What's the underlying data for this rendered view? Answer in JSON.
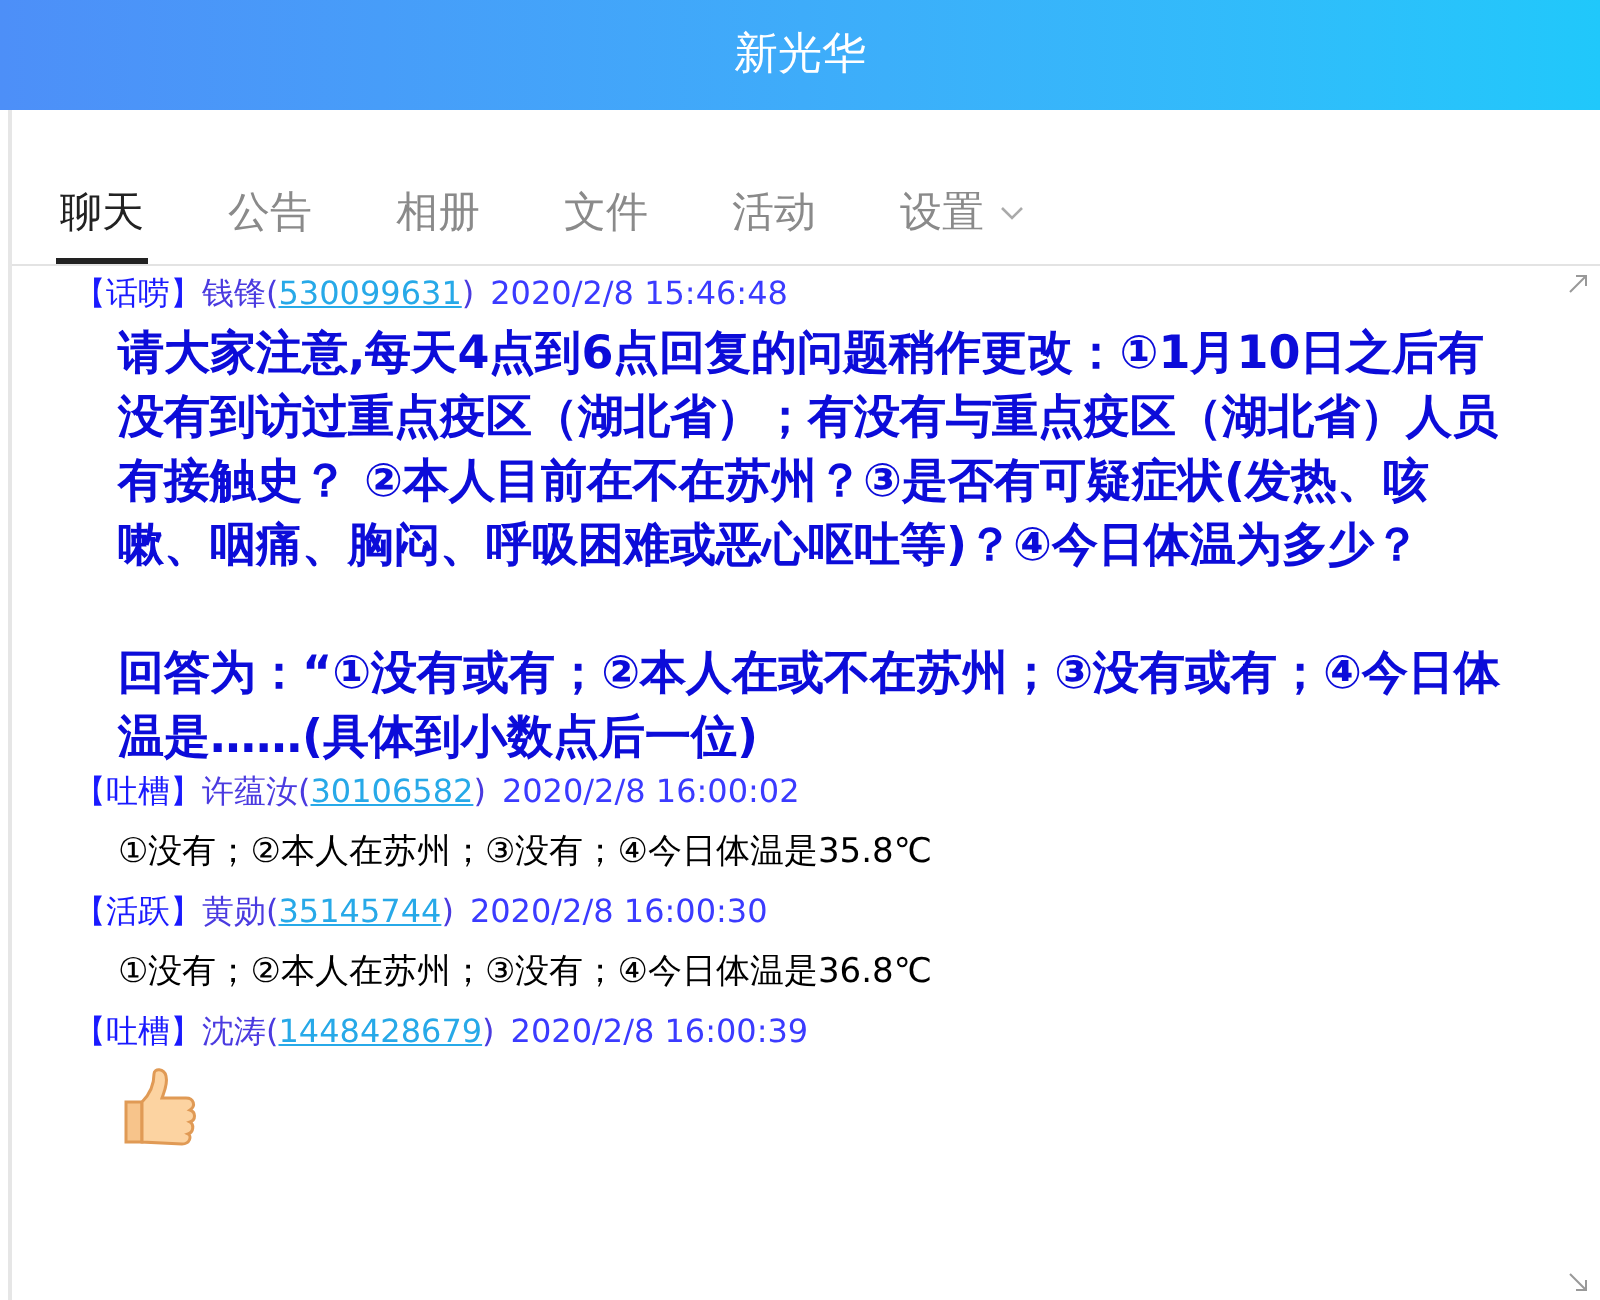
{
  "window": {
    "title": "新光华"
  },
  "tabs": [
    {
      "label": "聊天",
      "selected": true
    },
    {
      "label": "公告",
      "selected": false
    },
    {
      "label": "相册",
      "selected": false
    },
    {
      "label": "文件",
      "selected": false
    },
    {
      "label": "活动",
      "selected": false
    },
    {
      "label": "设置",
      "selected": false,
      "dropdown": true
    }
  ],
  "messages": [
    {
      "tag": "【话唠】",
      "name": "钱锋",
      "open": "(",
      "qq": "530099631",
      "close": ")",
      "time": "2020/2/8 15:46:48",
      "kind": "announcement",
      "paragraphs": [
        "请大家注意,每天4点到6点回复的问题稍作更改：①1月10日之后有没有到访过重点疫区（湖北省）；有没有与重点疫区（湖北省）人员有接触史？ ②本人目前在不在苏州？③是否有可疑症状(发热、咳嗽、咽痛、胸闷、呼吸困难或恶心呕吐等)？④今日体温为多少？",
        "回答为：“①没有或有；②本人在或不在苏州；③没有或有；④今日体温是……(具体到小数点后一位)"
      ]
    },
    {
      "tag": "【吐槽】",
      "name": "许蕴汝",
      "open": "(",
      "qq": "30106582",
      "close": ")",
      "time": "2020/2/8 16:00:02",
      "kind": "text",
      "text": "①没有；②本人在苏州；③没有；④今日体温是35.8℃"
    },
    {
      "tag": "【活跃】",
      "name": "黄勋",
      "open": "(",
      "qq": "35145744",
      "close": ")",
      "time": "2020/2/8 16:00:30",
      "kind": "text",
      "text": "①没有；②本人在苏州；③没有；④今日体温是36.8℃"
    },
    {
      "tag": "【吐槽】",
      "name": "沈涛",
      "open": "(",
      "qq": "1448428679",
      "close": ")",
      "time": "2020/2/8 16:00:39",
      "kind": "sticker"
    }
  ]
}
